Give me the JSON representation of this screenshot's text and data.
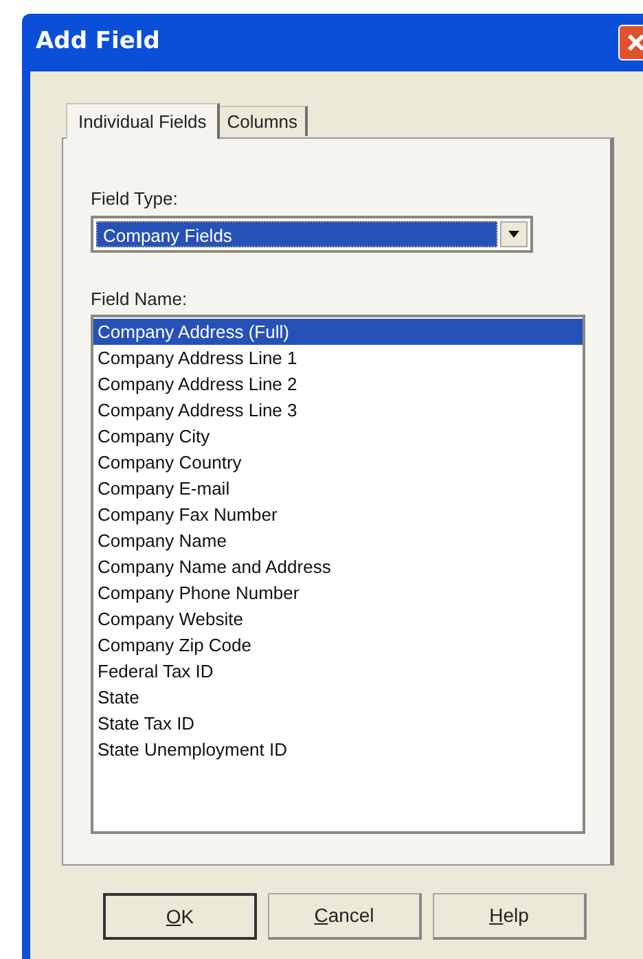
{
  "window": {
    "title": "Add Field"
  },
  "tabs": [
    {
      "label": "Individual Fields",
      "selected": true
    },
    {
      "label": "Columns",
      "selected": false
    }
  ],
  "field_type": {
    "label": "Field Type:",
    "value": "Company Fields"
  },
  "field_name": {
    "label": "Field Name:",
    "items": [
      {
        "label": "Company Address (Full)",
        "selected": true
      },
      {
        "label": "Company Address Line 1",
        "selected": false
      },
      {
        "label": "Company Address Line 2",
        "selected": false
      },
      {
        "label": "Company Address Line 3",
        "selected": false
      },
      {
        "label": "Company City",
        "selected": false
      },
      {
        "label": "Company Country",
        "selected": false
      },
      {
        "label": "Company E-mail",
        "selected": false
      },
      {
        "label": "Company Fax Number",
        "selected": false
      },
      {
        "label": "Company Name",
        "selected": false
      },
      {
        "label": "Company Name and Address",
        "selected": false
      },
      {
        "label": "Company Phone Number",
        "selected": false
      },
      {
        "label": "Company Website",
        "selected": false
      },
      {
        "label": "Company Zip Code",
        "selected": false
      },
      {
        "label": "Federal Tax ID",
        "selected": false
      },
      {
        "label": "State",
        "selected": false
      },
      {
        "label": "State Tax ID",
        "selected": false
      },
      {
        "label": "State Unemployment ID",
        "selected": false
      }
    ]
  },
  "buttons": [
    {
      "access_key": "O",
      "label_rest": "K",
      "default": true
    },
    {
      "access_key": "C",
      "label_rest": "ancel",
      "default": false
    },
    {
      "access_key": "H",
      "label_rest": "elp",
      "default": false
    }
  ]
}
